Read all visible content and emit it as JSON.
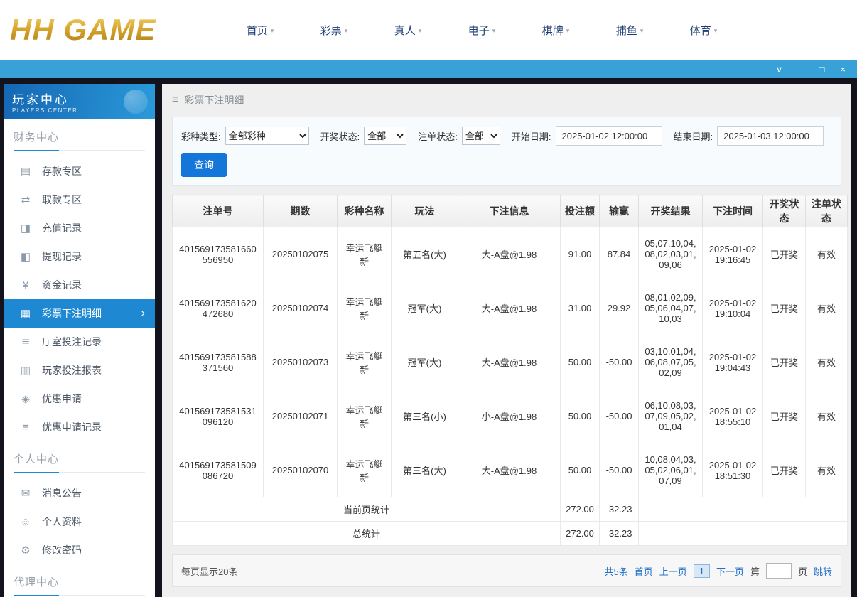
{
  "topnav": {
    "logo": "HH GAME",
    "items": [
      {
        "label": "首页"
      },
      {
        "label": "彩票"
      },
      {
        "label": "真人"
      },
      {
        "label": "电子"
      },
      {
        "label": "棋牌"
      },
      {
        "label": "捕鱼"
      },
      {
        "label": "体育"
      }
    ]
  },
  "icons": {
    "hamburger": "≡",
    "collapse": "∨",
    "minimize": "–",
    "maximize": "□",
    "close": "×",
    "nav_chevron": "▾",
    "active_arrow": "›"
  },
  "sidebar": {
    "title": "玩家中心",
    "subtitle": "PLAYERS CENTER",
    "sections": [
      {
        "label": "财务中心",
        "items": [
          {
            "key": "deposit",
            "icon": "deposit-icon",
            "glyph": "▤",
            "label": "存款专区"
          },
          {
            "key": "withdraw",
            "icon": "withdraw-icon",
            "glyph": "⇄",
            "label": "取款专区"
          },
          {
            "key": "recharge-record",
            "icon": "recharge-record-icon",
            "glyph": "◨",
            "label": "充值记录"
          },
          {
            "key": "withdraw-record",
            "icon": "withdraw-record-icon",
            "glyph": "◧",
            "label": "提现记录"
          },
          {
            "key": "funds-record",
            "icon": "funds-record-icon",
            "glyph": "¥",
            "label": "资金记录"
          },
          {
            "key": "lottery-bet-detail",
            "icon": "lottery-bet-detail-icon",
            "glyph": "▦",
            "label": "彩票下注明细",
            "active": true
          },
          {
            "key": "hall-bet-record",
            "icon": "hall-bet-record-icon",
            "glyph": "≣",
            "label": "厅室投注记录"
          },
          {
            "key": "player-bet-report",
            "icon": "player-bet-report-icon",
            "glyph": "▥",
            "label": "玩家投注报表"
          },
          {
            "key": "promo-apply",
            "icon": "promo-apply-icon",
            "glyph": "◈",
            "label": "优惠申请"
          },
          {
            "key": "promo-apply-record",
            "icon": "promo-apply-record-icon",
            "glyph": "≡",
            "label": "优惠申请记录"
          }
        ]
      },
      {
        "label": "个人中心",
        "items": [
          {
            "key": "announcement",
            "icon": "announcement-icon",
            "glyph": "✉",
            "label": "消息公告"
          },
          {
            "key": "profile",
            "icon": "profile-icon",
            "glyph": "☺",
            "label": "个人资料"
          },
          {
            "key": "password",
            "icon": "password-icon",
            "glyph": "⚙",
            "label": "修改密码"
          }
        ]
      },
      {
        "label": "代理中心",
        "items": []
      }
    ]
  },
  "breadcrumb": {
    "title": "彩票下注明细"
  },
  "filters": {
    "lottery_type_label": "彩种类型:",
    "lottery_type_value": "全部彩种",
    "draw_status_label": "开奖状态:",
    "draw_status_value": "全部",
    "order_status_label": "注单状态:",
    "order_status_value": "全部",
    "start_date_label": "开始日期:",
    "start_date_value": "2025-01-02 12:00:00",
    "end_date_label": "结束日期:",
    "end_date_value": "2025-01-03 12:00:00",
    "query_label": "查询"
  },
  "table": {
    "headers": [
      "注单号",
      "期数",
      "彩种名称",
      "玩法",
      "下注信息",
      "投注额",
      "输赢",
      "开奖结果",
      "下注时间",
      "开奖状态",
      "注单状态"
    ],
    "rows": [
      [
        "401569173581660556950",
        "20250102075",
        "幸运飞艇新",
        "第五名(大)",
        "大-A盘@1.98",
        "91.00",
        "87.84",
        "05,07,10,04,08,02,03,01,09,06",
        "2025-01-02 19:16:45",
        "已开奖",
        "有效"
      ],
      [
        "401569173581620472680",
        "20250102074",
        "幸运飞艇新",
        "冠军(大)",
        "大-A盘@1.98",
        "31.00",
        "29.92",
        "08,01,02,09,05,06,04,07,10,03",
        "2025-01-02 19:10:04",
        "已开奖",
        "有效"
      ],
      [
        "401569173581588371560",
        "20250102073",
        "幸运飞艇新",
        "冠军(大)",
        "大-A盘@1.98",
        "50.00",
        "-50.00",
        "03,10,01,04,06,08,07,05,02,09",
        "2025-01-02 19:04:43",
        "已开奖",
        "有效"
      ],
      [
        "401569173581531096120",
        "20250102071",
        "幸运飞艇新",
        "第三名(小)",
        "小-A盘@1.98",
        "50.00",
        "-50.00",
        "06,10,08,03,07,09,05,02,01,04",
        "2025-01-02 18:55:10",
        "已开奖",
        "有效"
      ],
      [
        "401569173581509086720",
        "20250102070",
        "幸运飞艇新",
        "第三名(大)",
        "大-A盘@1.98",
        "50.00",
        "-50.00",
        "10,08,04,03,05,02,06,01,07,09",
        "2025-01-02 18:51:30",
        "已开奖",
        "有效"
      ]
    ],
    "summary": [
      {
        "label": "当前页统计",
        "bet": "272.00",
        "winloss": "-32.23"
      },
      {
        "label": "总统计",
        "bet": "272.00",
        "winloss": "-32.23"
      }
    ]
  },
  "pagination": {
    "per_page": "每页显示20条",
    "total": "共5条",
    "first": "首页",
    "prev": "上一页",
    "current": "1",
    "next": "下一页",
    "jump_prefix": "第",
    "jump_suffix": "页",
    "jump_label": "跳转"
  }
}
